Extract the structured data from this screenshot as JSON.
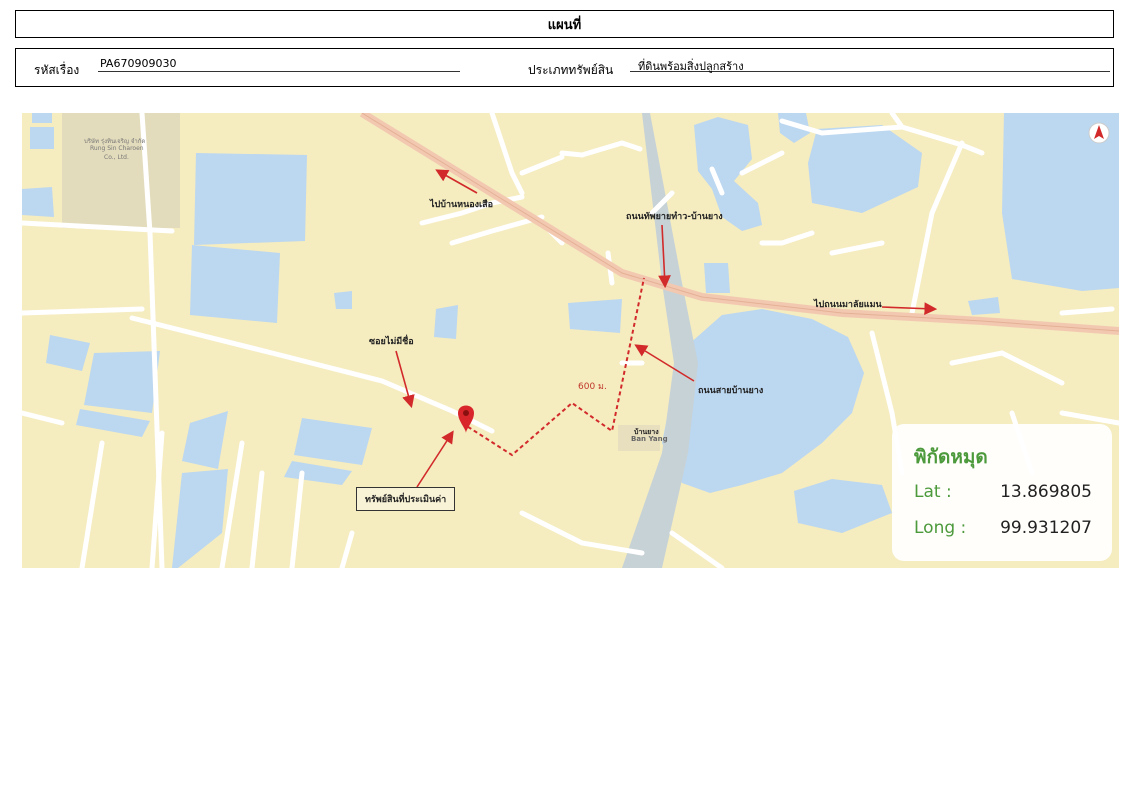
{
  "header": {
    "title": "แผนที่"
  },
  "info": {
    "case_label": "รหัสเรื่อง",
    "case_value": "PA670909030",
    "type_label": "ประเภททรัพย์สิน",
    "type_value": "ที่ดินพร้อมสิ่งปลูกสร้าง"
  },
  "map": {
    "labels": {
      "to_nong_suea": "ไปบ้านหนองเสือ",
      "road_thap": "ถนนทัพยายทำว-บ้านยาง",
      "to_nom": "ไปถนนมาลัยแมน",
      "soi": "ซอยไม่มีชื่อ",
      "road_ban_yang": "ถนนสายบ้านยาง",
      "distance": "600 ม.",
      "village_th": "บ้านยาง",
      "village_en": "Ban Yang",
      "property": "ทรัพย์สินที่ประเมินค่า",
      "company_th": "บริษัท รุ่งทินเจริญ จำกัด",
      "company_en1": "Rung Sin Charoen",
      "company_en2": "Co., Ltd."
    },
    "colors": {
      "land": "#f5ecc0",
      "water": "#bcd7f0",
      "road": "#ffffff",
      "highway": "#f2c9b0",
      "route": "#d22a2a",
      "pin": "#d8262a"
    },
    "icons": {
      "pin": "map-pin-icon",
      "compass": "compass-icon"
    }
  },
  "coords": {
    "title": "พิกัดหมุด",
    "lat_label": "Lat :",
    "lat_value": "13.869805",
    "long_label": "Long :",
    "long_value": "99.931207"
  }
}
